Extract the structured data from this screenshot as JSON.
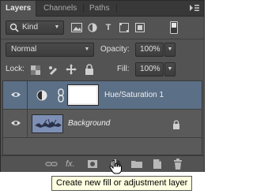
{
  "tabs": [
    {
      "label": "Layers",
      "active": true
    },
    {
      "label": "Channels",
      "active": false
    },
    {
      "label": "Paths",
      "active": false
    }
  ],
  "filter": {
    "kind_label": "Kind",
    "kind_icon": "search-icon"
  },
  "blend": {
    "mode": "Normal",
    "opacity_label": "Opacity:",
    "opacity_value": "100%"
  },
  "lock": {
    "label": "Lock:",
    "fill_label": "Fill:",
    "fill_value": "100%"
  },
  "layers": [
    {
      "name": "Hue/Saturation 1",
      "selected": true
    },
    {
      "name": "Background",
      "selected": false,
      "locked": true
    }
  ],
  "bottom_bar": {
    "fx_label": "fx."
  },
  "tooltip": {
    "text": "Create new fill or adjustment layer"
  },
  "colors": {
    "panel_bg": "#535353",
    "selected_row": "#5b6f86",
    "tooltip_bg": "#ffffe1"
  }
}
